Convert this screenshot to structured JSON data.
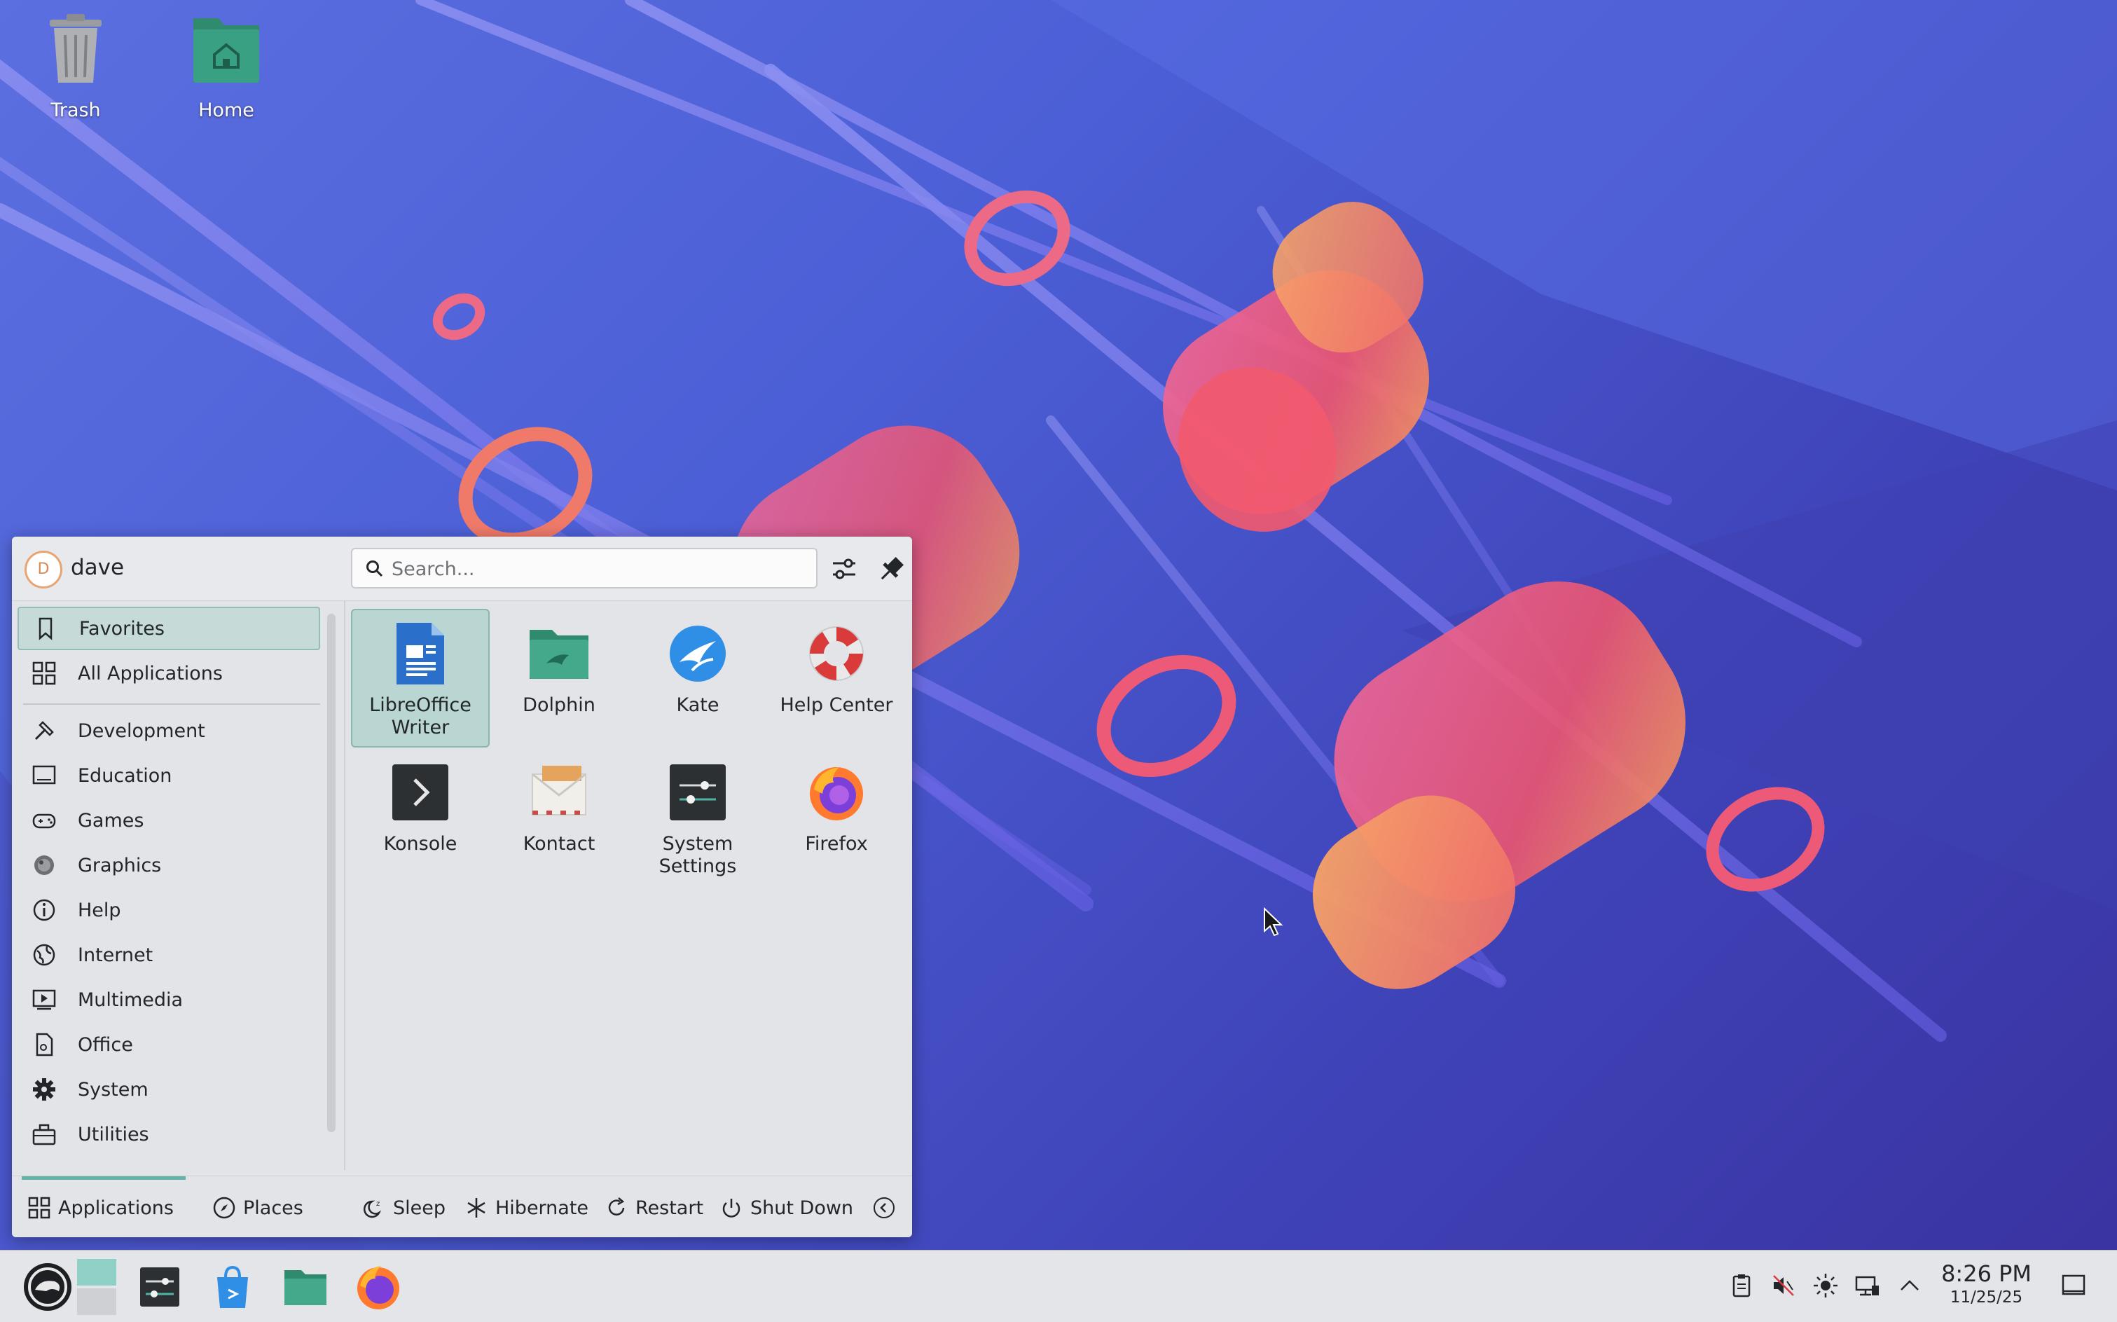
{
  "desktop": {
    "icons": [
      {
        "label": "Trash",
        "icon": "trash-icon"
      },
      {
        "label": "Home",
        "icon": "home-folder-icon"
      }
    ]
  },
  "launcher": {
    "user": {
      "initial": "D",
      "name": "dave"
    },
    "search": {
      "placeholder": "Search..."
    },
    "header_buttons": [
      {
        "icon": "sliders-icon"
      },
      {
        "icon": "pin-icon"
      }
    ],
    "categories": [
      {
        "label": "Favorites",
        "icon": "bookmark-icon",
        "active": true
      },
      {
        "label": "All Applications",
        "icon": "grid-icon"
      },
      {
        "label": "Development",
        "icon": "hammer-icon"
      },
      {
        "label": "Education",
        "icon": "monitor-icon"
      },
      {
        "label": "Games",
        "icon": "gamepad-icon"
      },
      {
        "label": "Graphics",
        "icon": "palette-icon"
      },
      {
        "label": "Help",
        "icon": "info-icon"
      },
      {
        "label": "Internet",
        "icon": "globe-icon"
      },
      {
        "label": "Multimedia",
        "icon": "media-icon"
      },
      {
        "label": "Office",
        "icon": "document-icon"
      },
      {
        "label": "System",
        "icon": "gear-icon"
      },
      {
        "label": "Utilities",
        "icon": "toolbox-icon"
      }
    ],
    "favorites": [
      {
        "label": "LibreOffice Writer",
        "line1": "LibreOffice",
        "line2": "Writer",
        "icon": "writer-icon",
        "active": true
      },
      {
        "label": "Dolphin",
        "line1": "Dolphin",
        "line2": "",
        "icon": "folder-icon"
      },
      {
        "label": "Kate",
        "line1": "Kate",
        "line2": "",
        "icon": "kate-icon"
      },
      {
        "label": "Help Center",
        "line1": "Help Center",
        "line2": "",
        "icon": "lifebuoy-icon"
      },
      {
        "label": "Konsole",
        "line1": "Konsole",
        "line2": "",
        "icon": "terminal-icon"
      },
      {
        "label": "Kontact",
        "line1": "Kontact",
        "line2": "",
        "icon": "mail-icon"
      },
      {
        "label": "System Settings",
        "line1": "System",
        "line2": "Settings",
        "icon": "settings-icon"
      },
      {
        "label": "Firefox",
        "line1": "Firefox",
        "line2": "",
        "icon": "firefox-icon"
      }
    ],
    "footer": {
      "applications": "Applications",
      "places": "Places",
      "sleep": "Sleep",
      "hibernate": "Hibernate",
      "restart": "Restart",
      "shutdown": "Shut Down"
    }
  },
  "taskbar": {
    "items": [
      {
        "name": "application-launcher",
        "icon": "opensuse-icon"
      },
      {
        "name": "pager",
        "icon": "pager-icon"
      },
      {
        "name": "system-settings",
        "icon": "settings-icon"
      },
      {
        "name": "discover",
        "icon": "discover-icon"
      },
      {
        "name": "dolphin",
        "icon": "folder-icon"
      },
      {
        "name": "firefox",
        "icon": "firefox-icon"
      }
    ],
    "tray": [
      "clipboard-icon",
      "volume-muted-icon",
      "brightness-icon",
      "network-icon",
      "chevron-up-icon"
    ],
    "clock": {
      "time": "8:26 PM",
      "date": "11/25/25"
    }
  },
  "colors": {
    "accent": "#5fb3a7",
    "wallpaper_primary": "#4c5fd6",
    "wallpaper_secondary": "#3a32a0",
    "tube_pink": "#e9576f",
    "tube_orange": "#f6a05e"
  }
}
